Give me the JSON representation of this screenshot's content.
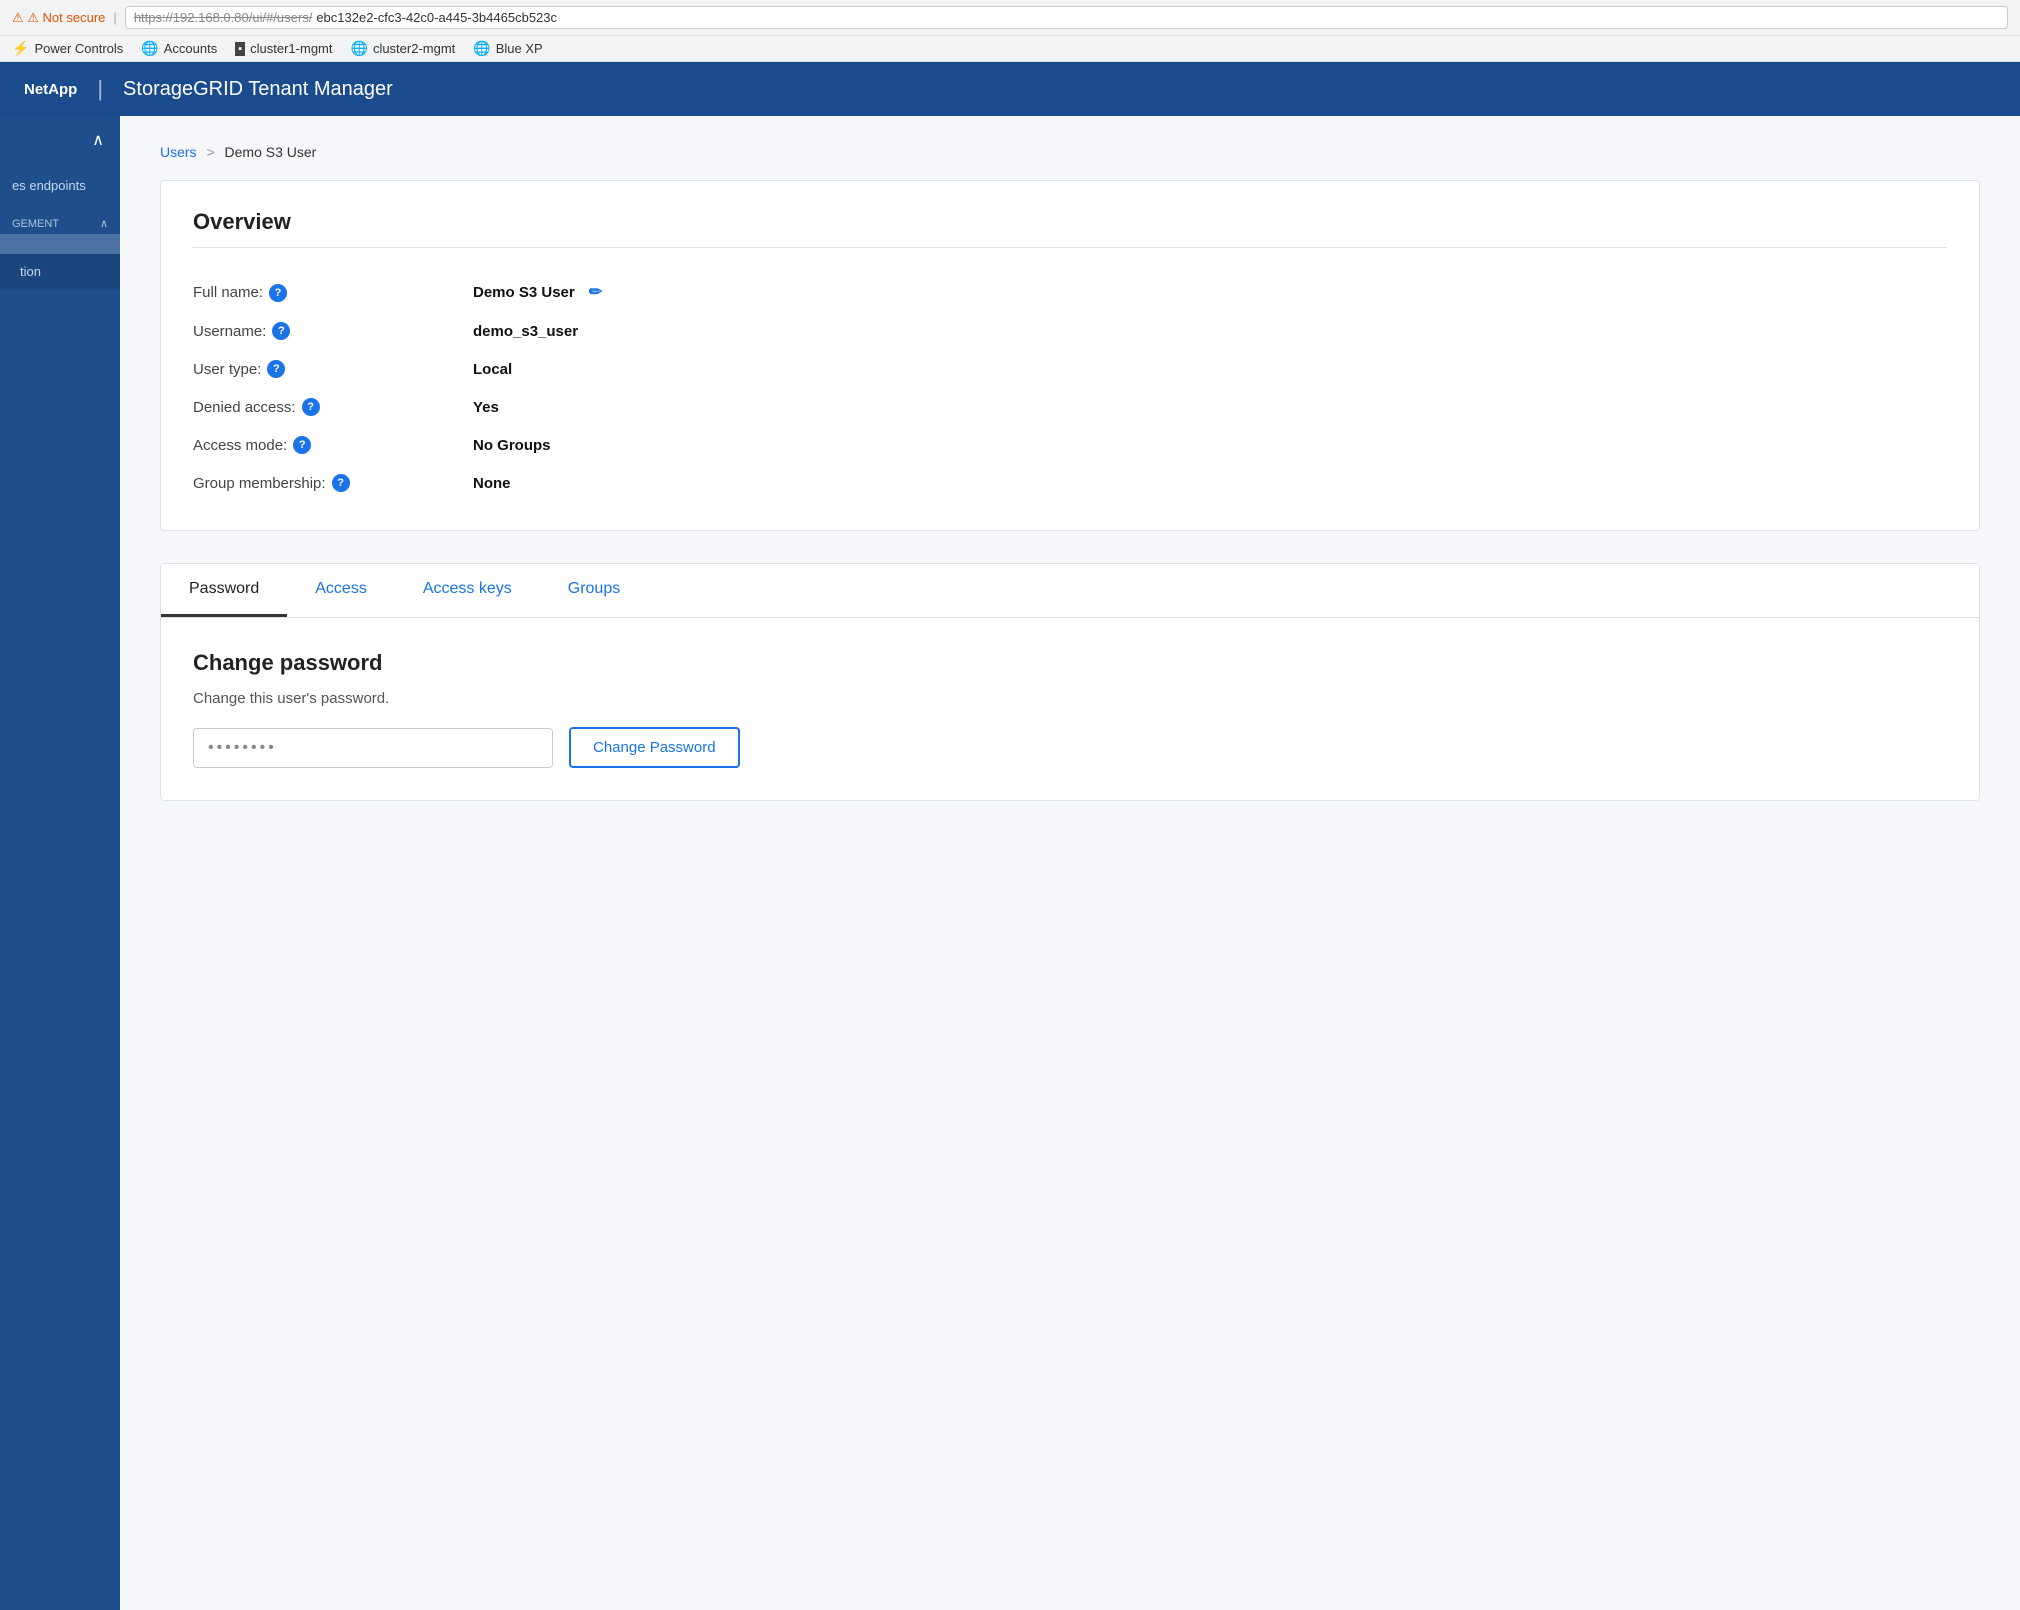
{
  "browser": {
    "security_warning": "⚠ Not secure",
    "url_strikethrough": "https://192.168.0.80/ui/#/users/",
    "url_highlight": "ebc132e2-cfc3-42c0-a445-3b4465cb523c",
    "full_url": "https://192.168.0.80/ui/#/users/ebc132e2-cfc3-42c0-a445-3b4465cb523c"
  },
  "bookmarks": [
    {
      "label": "Power Controls",
      "icon": "⚡"
    },
    {
      "label": "Accounts",
      "icon": "🌐"
    },
    {
      "label": "cluster1-mgmt",
      "icon": "▪"
    },
    {
      "label": "cluster2-mgmt",
      "icon": "🌐"
    },
    {
      "label": "Blue XP",
      "icon": "🌐"
    }
  ],
  "header": {
    "brand": "NetApp",
    "separator": "|",
    "title": "StorageGRID Tenant Manager"
  },
  "sidebar": {
    "toggle_icon": "∧",
    "items": [
      {
        "label": "es endpoints",
        "active": false
      },
      {
        "label": "GEMENT",
        "section": true
      },
      {
        "label": "tion",
        "sub": true
      }
    ]
  },
  "breadcrumb": {
    "parent": "Users",
    "separator": ">",
    "current": "Demo S3 User"
  },
  "overview": {
    "title": "Overview",
    "fields": [
      {
        "label": "Full name:",
        "tooltip": true,
        "value": "Demo S3 User",
        "editable": true
      },
      {
        "label": "Username:",
        "tooltip": true,
        "value": "demo_s3_user",
        "editable": false
      },
      {
        "label": "User type:",
        "tooltip": true,
        "value": "Local",
        "editable": false
      },
      {
        "label": "Denied access:",
        "tooltip": true,
        "value": "Yes",
        "editable": false
      },
      {
        "label": "Access mode:",
        "tooltip": true,
        "value": "No Groups",
        "editable": false
      },
      {
        "label": "Group membership:",
        "tooltip": true,
        "value": "None",
        "editable": false
      }
    ]
  },
  "tabs": {
    "items": [
      {
        "label": "Password",
        "active": true
      },
      {
        "label": "Access",
        "active": false
      },
      {
        "label": "Access keys",
        "active": false
      },
      {
        "label": "Groups",
        "active": false
      }
    ]
  },
  "password_tab": {
    "title": "Change password",
    "description": "Change this user's password.",
    "placeholder": "••••••••",
    "button_label": "Change Password"
  },
  "colors": {
    "brand_blue": "#1a4b8c",
    "link_blue": "#1a73e8",
    "sidebar_bg": "#1e4f8c"
  }
}
